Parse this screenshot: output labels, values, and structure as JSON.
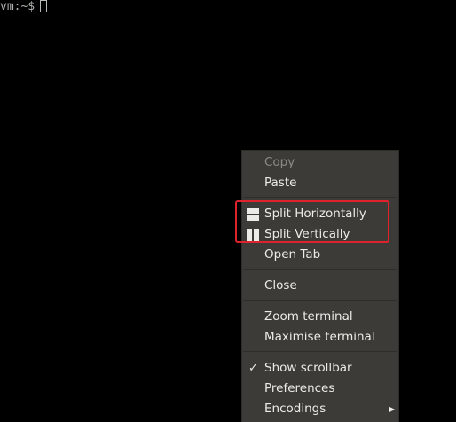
{
  "terminal": {
    "prompt": "vm:~$"
  },
  "context_menu": {
    "copy": "Copy",
    "paste": "Paste",
    "split_horizontally": "Split Horizontally",
    "split_vertically": "Split Vertically",
    "open_tab": "Open Tab",
    "close": "Close",
    "zoom_terminal": "Zoom terminal",
    "maximise_terminal": "Maximise terminal",
    "show_scrollbar": "Show scrollbar",
    "show_scrollbar_checked": true,
    "preferences": "Preferences",
    "encodings": "Encodings"
  },
  "icons": {
    "split_horizontally": "split-horizontal-icon",
    "split_vertically": "split-vertical-icon",
    "show_scrollbar_check": "checkmark-icon",
    "encodings_arrow": "submenu-arrow-icon"
  },
  "colors": {
    "terminal_bg": "#000000",
    "menu_bg": "#3c3b37",
    "menu_text": "#ecebe8",
    "disabled_text": "#8c8a84",
    "annotation_red": "#e0222d"
  }
}
